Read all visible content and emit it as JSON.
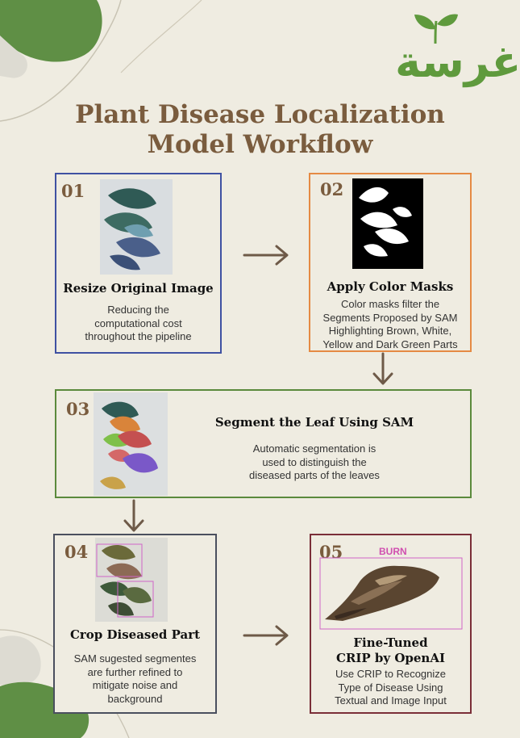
{
  "logo": {
    "text": "غرسة",
    "brand_color": "#5f9a3d"
  },
  "title": {
    "line1": "Plant Disease Localization",
    "line2": "Model Workflow"
  },
  "colors": {
    "title": "#7a5c3e",
    "step1_border": "#3f51a2",
    "step2_border": "#e58a43",
    "step3_border": "#5b8a3c",
    "step4_border": "#4a4f5e",
    "step5_border": "#7a2e38",
    "arrow": "#6e5a48",
    "burn_label": "#d04fb0"
  },
  "steps": [
    {
      "number": "01",
      "title": "Resize Original Image",
      "description": "Reducing the\ncomputational cost\nthroughout the pipeline"
    },
    {
      "number": "02",
      "title": "Apply Color Masks",
      "description": "Color masks filter the\nSegments Proposed by SAM\nHighlighting Brown, White,\nYellow and Dark Green Parts"
    },
    {
      "number": "03",
      "title": "Segment the Leaf Using SAM",
      "description": "Automatic segmentation is\nused to distinguish the\ndiseased parts of the leaves"
    },
    {
      "number": "04",
      "title": "Crop Diseased Part",
      "description": "SAM sugested segmentes\nare further refined to\nmitigate noise and\nbackground"
    },
    {
      "number": "05",
      "title_line1": "Fine-Tuned",
      "title_line2": "CRIP by OpenAI",
      "description": "Use CRIP to Recognize\nType of Disease Using\nTextual and Image Input",
      "detection_label": "BURN"
    }
  ],
  "icons": [
    "leaf-sprout-icon",
    "arrow-right-icon",
    "arrow-down-icon"
  ]
}
